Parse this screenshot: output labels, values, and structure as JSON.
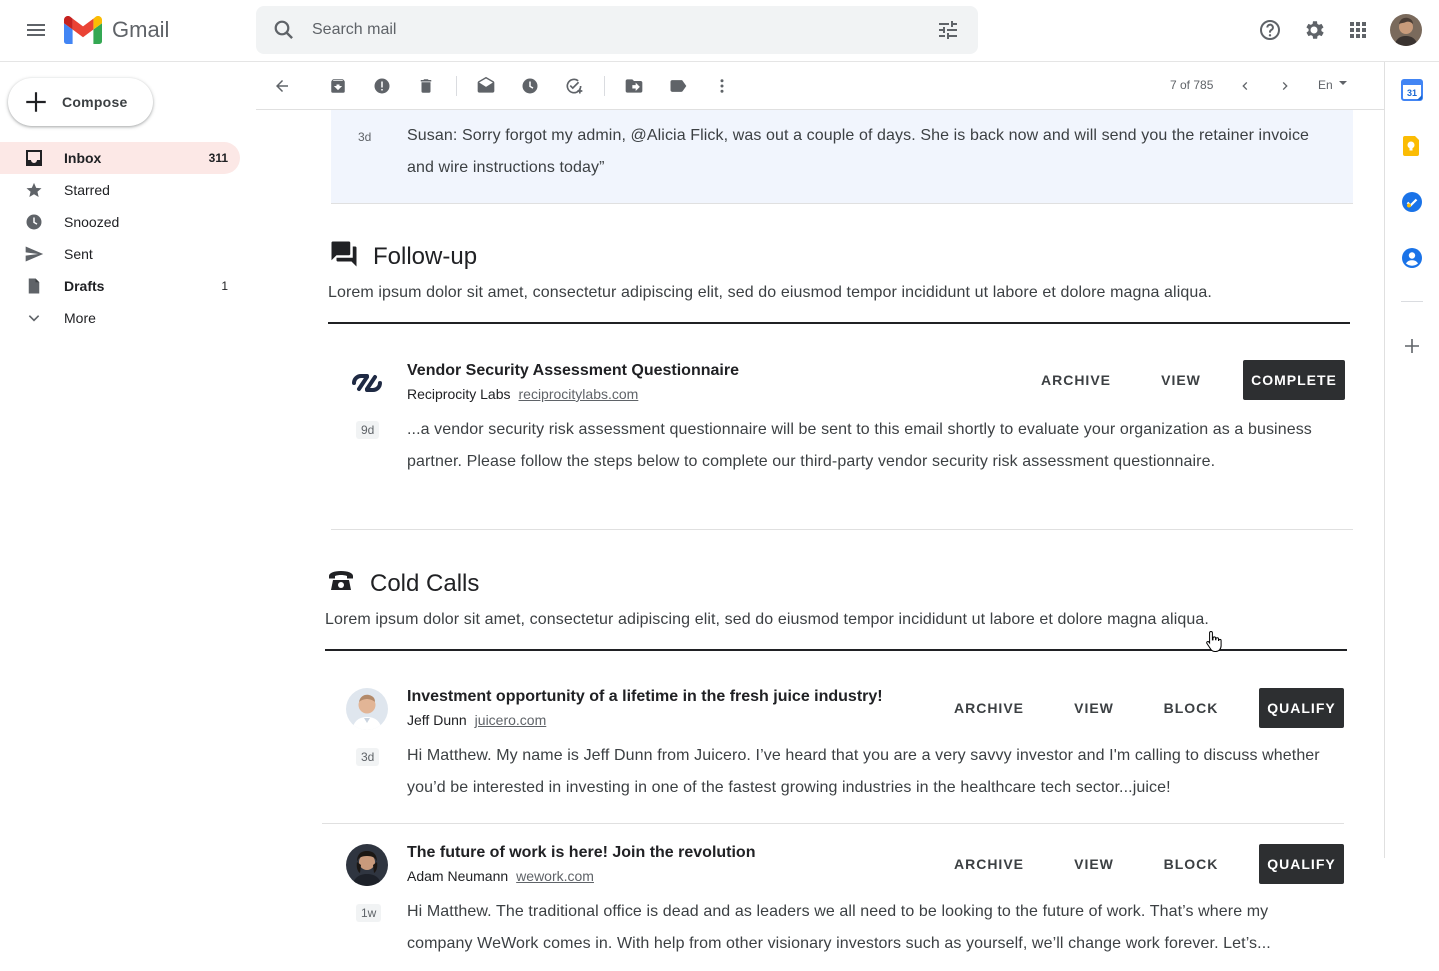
{
  "app": {
    "name": "Gmail",
    "brand_colors": {
      "red": "#ea4335",
      "blue": "#4285f4",
      "green": "#34a853",
      "yellow": "#fbbc04"
    }
  },
  "search": {
    "placeholder": "Search mail"
  },
  "header_icons": [
    "help-icon",
    "settings-icon",
    "apps-grid-icon",
    "account-avatar"
  ],
  "sidebar": {
    "compose_label": "Compose",
    "items": [
      {
        "label": "Inbox",
        "count": "311",
        "icon": "inbox-icon",
        "active": true
      },
      {
        "label": "Starred",
        "count": "",
        "icon": "star-icon"
      },
      {
        "label": "Snoozed",
        "count": "",
        "icon": "clock-icon"
      },
      {
        "label": "Sent",
        "count": "",
        "icon": "send-icon"
      },
      {
        "label": "Drafts",
        "count": "1",
        "icon": "draft-icon"
      },
      {
        "label": "More",
        "count": "",
        "icon": "chevron-down-icon"
      }
    ]
  },
  "toolbar": {
    "icons": [
      "back-arrow-icon",
      "archive-icon",
      "report-spam-icon",
      "delete-icon",
      "mark-unread-icon",
      "snooze-icon",
      "add-task-icon",
      "move-to-icon",
      "label-icon",
      "more-vert-icon"
    ],
    "pager": "7 of 785",
    "language": "En"
  },
  "right_rail": [
    "calendar-icon",
    "keep-icon",
    "tasks-icon",
    "contacts-icon",
    "add-addon-icon"
  ],
  "calendar_day": "31",
  "previous_message": {
    "age": "3d",
    "text": "Susan: Sorry forgot my admin, @Alicia Flick, was out a couple of days. She is back now and will send you the retainer invoice and wire instructions today”"
  },
  "sections": [
    {
      "title": "Follow-up",
      "icon": "forum-icon",
      "description": "Lorem ipsum dolor sit amet, consectetur adipiscing elit, sed do eiusmod tempor incididunt ut labore et dolore magna aliqua.",
      "mails": [
        {
          "subject": "Vendor Security Assessment Questionnaire",
          "sender": "Reciprocity Labs",
          "domain": "reciprocitylabs.com",
          "age": "9d",
          "body": "...a vendor security risk assessment questionnaire will be sent to this email shortly to evaluate your organization as a business partner. Please follow the steps below to complete our third-party vendor security risk assessment questionnaire.",
          "actions": [
            "ARCHIVE",
            "VIEW"
          ],
          "primary_action": "COMPLETE"
        }
      ]
    },
    {
      "title": "Cold Calls",
      "icon": "phone-icon",
      "description": "Lorem ipsum dolor sit amet, consectetur adipiscing elit, sed do eiusmod tempor incididunt ut labore et dolore magna aliqua.",
      "mails": [
        {
          "subject": "Investment opportunity of a lifetime in the fresh juice industry!",
          "sender": "Jeff Dunn",
          "domain": "juicero.com",
          "age": "3d",
          "body": "Hi Matthew. My name is Jeff Dunn from Juicero. I’ve heard that you are a very savvy investor and I'm calling to discuss whether you’d be interested in investing in one of the fastest growing industries in the healthcare tech sector...juice!",
          "actions": [
            "ARCHIVE",
            "VIEW",
            "BLOCK"
          ],
          "primary_action": "QUALIFY"
        },
        {
          "subject": "The future of work is here! Join the revolution",
          "sender": "Adam Neumann",
          "domain": "wework.com",
          "age": "1w",
          "body": "Hi Matthew. The traditional office is dead and as leaders we all need to be looking to the future of work. That’s where my company WeWork comes in. With help from other visionary investors such as yourself, we’ll change work forever. Let’s...",
          "actions": [
            "ARCHIVE",
            "VIEW",
            "BLOCK"
          ],
          "primary_action": "QUALIFY"
        }
      ]
    }
  ]
}
